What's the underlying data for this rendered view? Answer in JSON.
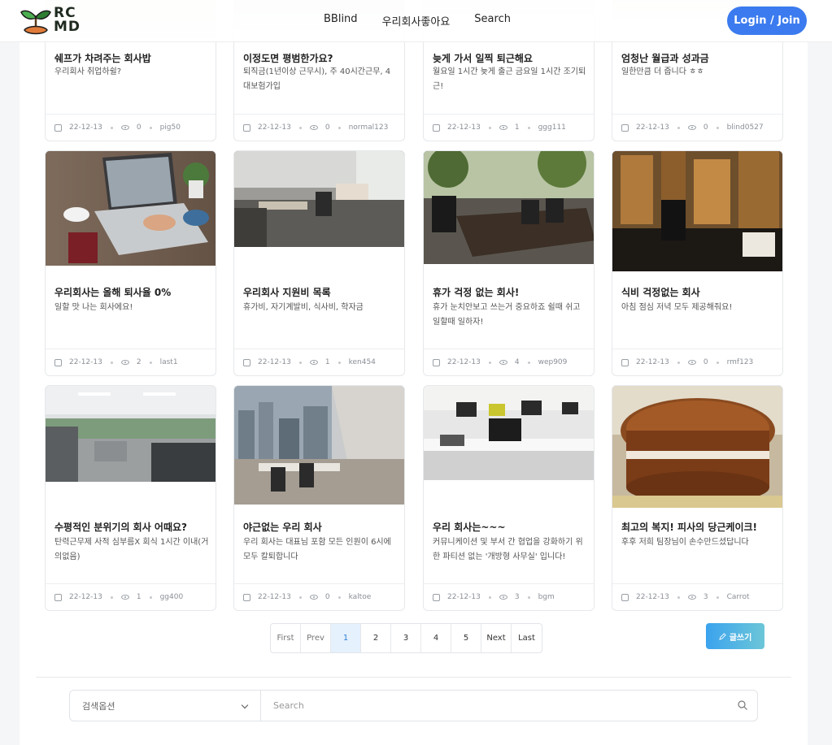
{
  "header": {
    "logo_text_top": "RC",
    "logo_text_bottom": "MD",
    "nav": [
      "BBlind",
      "우리회사좋아요",
      "Search"
    ],
    "login_label": "Login / Join",
    "accent": "#3b7bef"
  },
  "cards": [
    {
      "title": "쉐프가 차려주는 회사밥",
      "desc": "우리회사 취업하쉴?",
      "date": "22-12-13",
      "views": "0",
      "author": "pig50",
      "image": "food-photo"
    },
    {
      "title": "이정도면 평범한가요?",
      "desc": "퇴직금(1년이상 근무시), 주 40시간근무, 4대보험가입",
      "date": "22-12-13",
      "views": "0",
      "author": "normal123",
      "image": "office-photo"
    },
    {
      "title": "늦게 가서 일찍 퇴근해요",
      "desc": "월요일 1시간 늦게 출근 금요일 1시간 조기퇴근!",
      "date": "22-12-13",
      "views": "1",
      "author": "ggg111",
      "image": "office-photo"
    },
    {
      "title": "엄청난 월급과 성과금",
      "desc": "일한만큼 더 줍니다 ㅎㅎ",
      "date": "22-12-13",
      "views": "0",
      "author": "blind0527",
      "image": "office-photo"
    },
    {
      "title": "우리회사는 올해 퇴사율 0%",
      "desc": "일할 맛 나는 회사에요!",
      "date": "22-12-13",
      "views": "2",
      "author": "last1",
      "image": "laptop-desk-photo"
    },
    {
      "title": "우리회사 지원비 목록",
      "desc": "휴가비, 자기계발비, 식사비, 학자금",
      "date": "22-12-13",
      "views": "1",
      "author": "ken454",
      "image": "open-office-photo"
    },
    {
      "title": "휴가 걱정 없는 회사!",
      "desc": "휴가 눈치안보고 쓰는거 중요하죠 쉴때 쉬고 일할때 일하자!",
      "date": "22-12-13",
      "views": "4",
      "author": "wep909",
      "image": "meeting-room-photo"
    },
    {
      "title": "식비 걱정없는 회사",
      "desc": "아침 점심 저녁 모두 제공해줘요!",
      "date": "22-12-13",
      "views": "0",
      "author": "rmf123",
      "image": "night-office-photo"
    },
    {
      "title": "수평적인 분위기의 회사 어때요?",
      "desc": "탄력근무제   사적 심부름X   회식 1시간 이내(거의없음)",
      "date": "22-12-13",
      "views": "1",
      "author": "gg400",
      "image": "cubicles-photo"
    },
    {
      "title": "야근없는 우리 회사",
      "desc": "우리 회사는 대표님 포함 모든 인원이 6시에 모두 칼퇴합니다",
      "date": "22-12-13",
      "views": "0",
      "author": "kaltoe",
      "image": "city-office-photo"
    },
    {
      "title": "우리 회사는~~~",
      "desc": "커뮤니케이션 및 부서 간 협업을 강화하기 위한 파티션 없는 '개방형 사무실' 입니다!",
      "date": "22-12-13",
      "views": "3",
      "author": "bgm",
      "image": "white-desks-photo"
    },
    {
      "title": "최고의 복지! 피사의 당근케이크!",
      "desc": "후후 저희 팀장님이 손수만드셨답니다",
      "date": "22-12-13",
      "views": "3",
      "author": "Carrot",
      "image": "carrot-cake-photo"
    }
  ],
  "pagination": {
    "first": "First",
    "prev": "Prev",
    "pages": [
      "1",
      "2",
      "3",
      "4",
      "5"
    ],
    "next": "Next",
    "last": "Last",
    "current": "1"
  },
  "write_button": "글쓰기",
  "search": {
    "option": "검색옵션",
    "placeholder": "Search"
  }
}
